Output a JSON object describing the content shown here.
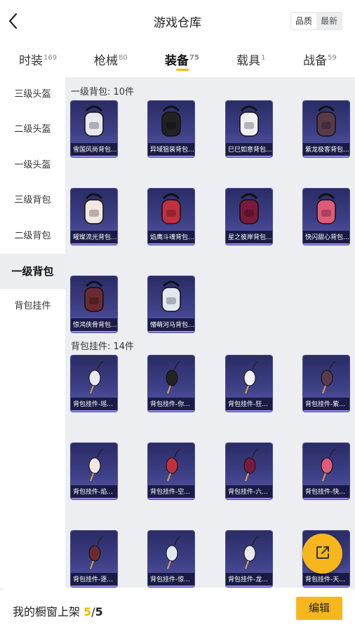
{
  "header": {
    "title": "游戏仓库",
    "sort_options": [
      "品质",
      "最新"
    ],
    "active_sort": "最新"
  },
  "tabs": [
    {
      "label": "时装",
      "count": "169"
    },
    {
      "label": "枪械",
      "count": "80"
    },
    {
      "label": "装备",
      "count": "75",
      "active": true
    },
    {
      "label": "载具",
      "count": "1"
    },
    {
      "label": "战备",
      "count": "59"
    }
  ],
  "sidebar": {
    "items": [
      "三级头盔",
      "二级头盔",
      "一级头盔",
      "三级背包",
      "二级背包",
      "一级背包",
      "背包挂件"
    ],
    "active": "一级背包"
  },
  "sections": [
    {
      "title": "一级背包: 10件",
      "items": [
        {
          "label": "雪国风尚背包...",
          "icon": "bunny-backpack-icon"
        },
        {
          "label": "异域狙装背包...",
          "icon": "dark-backpack-icon"
        },
        {
          "label": "巳巳如意背包...",
          "icon": "white-backpack-icon"
        },
        {
          "label": "紫龙极客背包...",
          "icon": "purple-backpack-icon"
        },
        {
          "label": "曜璨流光背包...",
          "icon": "gold-backpack-icon"
        },
        {
          "label": "焰鹰斗魂背包...",
          "icon": "red-backpack-icon"
        },
        {
          "label": "星之彼岸背包...",
          "icon": "eye-backpack-icon"
        },
        {
          "label": "快闪甜心背包...",
          "icon": "pink-backpack-icon"
        },
        {
          "label": "惊鸿侠骨背包...",
          "icon": "maroon-backpack-icon"
        },
        {
          "label": "懵萌河马背包...",
          "icon": "hippo-backpack-icon"
        }
      ]
    },
    {
      "title": "背包挂件: 14件",
      "items": [
        {
          "label": "背包挂件-瑶...",
          "icon": "charm-icon"
        },
        {
          "label": "背包挂件-你...",
          "icon": "penguin-charm-icon"
        },
        {
          "label": "背包挂件-狂...",
          "icon": "claw-charm-icon"
        },
        {
          "label": "背包挂件-紫...",
          "icon": "mask-charm-icon"
        },
        {
          "label": "背包挂件-焰...",
          "icon": "red-charm-icon"
        },
        {
          "label": "背包挂件-空...",
          "icon": "fish-charm-icon"
        },
        {
          "label": "背包挂件-六...",
          "icon": "leaf-charm-icon"
        },
        {
          "label": "背包挂件-快...",
          "icon": "pink-charm-icon"
        },
        {
          "label": "背包挂件-逐...",
          "icon": "tassel-charm-icon"
        },
        {
          "label": "背包挂件-惊...",
          "icon": "ring-charm-icon"
        },
        {
          "label": "背包挂件-龙...",
          "icon": "lion-charm-icon"
        },
        {
          "label": "背包挂件-天...",
          "icon": "wing-charm-icon"
        }
      ]
    }
  ],
  "footer": {
    "label": "我的橱窗上架",
    "current": "5",
    "separator": "/",
    "total": "5",
    "edit_label": "编辑"
  },
  "colors": {
    "accent": "#f7b71c",
    "card_bg": "#3d3f86",
    "content_bg": "#eceef2"
  }
}
